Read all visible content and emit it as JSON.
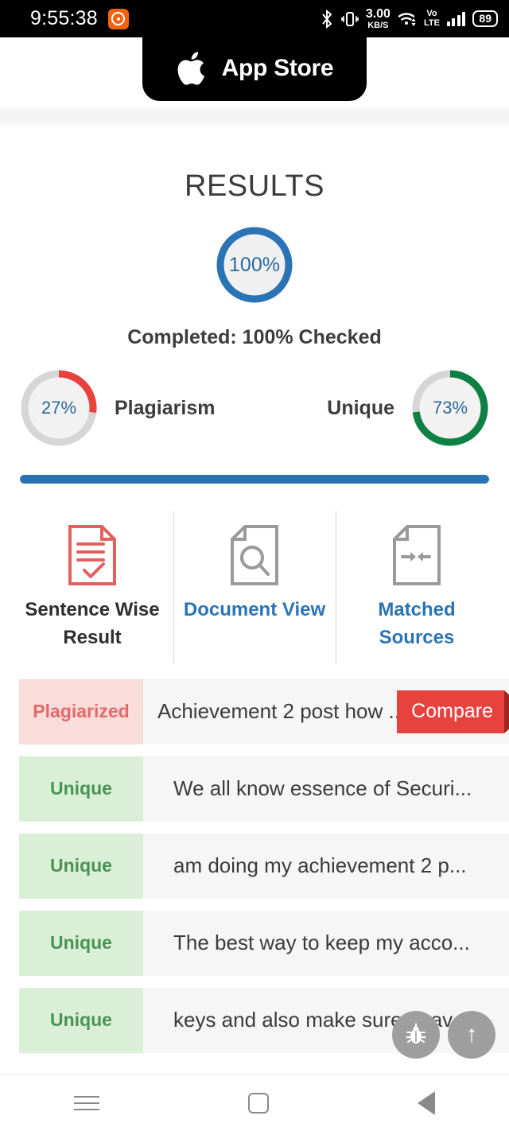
{
  "status_bar": {
    "clock": "9:55:38",
    "mi_badge_icon": "mi-circle-icon",
    "bluetooth_icon": "bluetooth-icon",
    "vibrate_icon": "vibrate-icon",
    "net_speed_value": "3.00",
    "net_speed_unit": "KB/S",
    "wifi_icon": "wifi-icon",
    "volte_top": "Vo",
    "volte_bottom": "LTE",
    "signal_icon": "signal-bars-icon",
    "battery_level": "89"
  },
  "banner": {
    "store_name": "App Store",
    "logo_icon": "apple-logo-icon"
  },
  "results": {
    "title": "RESULTS",
    "main_gauge": {
      "label": "100%",
      "value": 100,
      "color": "#2a74b6"
    },
    "completed_text": "Completed: 100% Checked",
    "plagiarism_gauge": {
      "label": "27%",
      "value": 27,
      "caption": "Plagiarism",
      "color": "#e8423f"
    },
    "unique_gauge": {
      "label": "73%",
      "value": 73,
      "caption": "Unique",
      "color": "#0e8044"
    },
    "progress_percent": 100,
    "progress_color": "#2a74b6"
  },
  "tabs": [
    {
      "label": "Sentence Wise Result",
      "icon": "document-check-icon",
      "active": true,
      "icon_color": "#e2615e"
    },
    {
      "label": "Document View",
      "icon": "document-search-icon",
      "active": false,
      "icon_color": "#9a9a9a"
    },
    {
      "label": "Matched Sources",
      "icon": "document-arrows-icon",
      "active": false,
      "icon_color": "#9a9a9a"
    }
  ],
  "sentence_rows": [
    {
      "tag": "Plagiarized",
      "status": "plagiarized",
      "text": "Achievement 2 post how ...",
      "action": "Compare"
    },
    {
      "tag": "Unique",
      "status": "unique",
      "text": "We all know essence of Securi..."
    },
    {
      "tag": "Unique",
      "status": "unique",
      "text": "am doing my achievement 2 p..."
    },
    {
      "tag": "Unique",
      "status": "unique",
      "text": "The best way to keep my acco..."
    },
    {
      "tag": "Unique",
      "status": "unique",
      "text": "keys and also make sure to av..."
    }
  ],
  "floating_buttons": [
    {
      "icon": "bug-icon",
      "name": "report-bug-fab"
    },
    {
      "icon": "arrow-up-icon",
      "glyph": "↑",
      "name": "scroll-to-top-fab"
    }
  ],
  "nav_bar": {
    "recents_icon": "hamburger-icon",
    "home_icon": "home-square-icon",
    "back_icon": "back-triangle-icon"
  }
}
